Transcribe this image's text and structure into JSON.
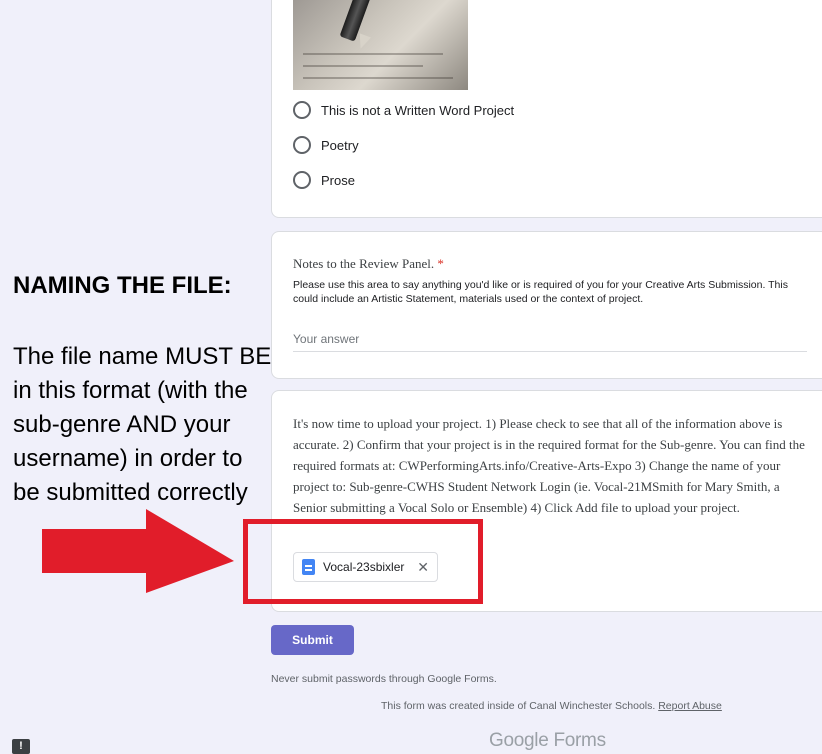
{
  "options_card": {
    "image_icon": "pen-writing-photo",
    "options": [
      {
        "label": "This is not a Written Word Project"
      },
      {
        "label": "Poetry"
      },
      {
        "label": "Prose"
      }
    ]
  },
  "notes_card": {
    "title": "Notes to the Review Panel.",
    "required_mark": "*",
    "description": "Please use this area to say anything you'd like or is required of you for your Creative Arts Submission. This could include an Artistic Statement, materials used or the context of project.",
    "placeholder": "Your answer"
  },
  "upload_card": {
    "description": "It's now time to upload your project. 1) Please check to see that all of the information above is accurate. 2) Confirm that your project is in the required format for the Sub-genre. You can find the required formats at: CWPerformingArts.info/Creative-Arts-Expo 3) Change the name of your project to: Sub-genre-CWHS Student Network Login (ie. Vocal-21MSmith for Mary Smith, a Senior submitting a Vocal Solo or Ensemble) 4) Click Add file to upload your project.",
    "file_name": "Vocal-23sbixler",
    "file_icon": "google-doc-icon",
    "close_glyph": "✕"
  },
  "footer": {
    "submit_label": "Submit",
    "warning": "Never submit passwords through Google Forms.",
    "creator_text": "This form was created inside of Canal Winchester Schools.",
    "report_abuse": "Report Abuse",
    "brand_google": "Google",
    "brand_forms": "Forms",
    "feedback_glyph": "!"
  },
  "overlay": {
    "heading": "NAMING THE FILE:",
    "text": "The file name MUST BE in this format (with the sub-genre AND your username) in order to be submitted correctly"
  },
  "colors": {
    "accent": "#6768c8",
    "highlight": "#e11d2a",
    "background": "#f0f0fa"
  }
}
